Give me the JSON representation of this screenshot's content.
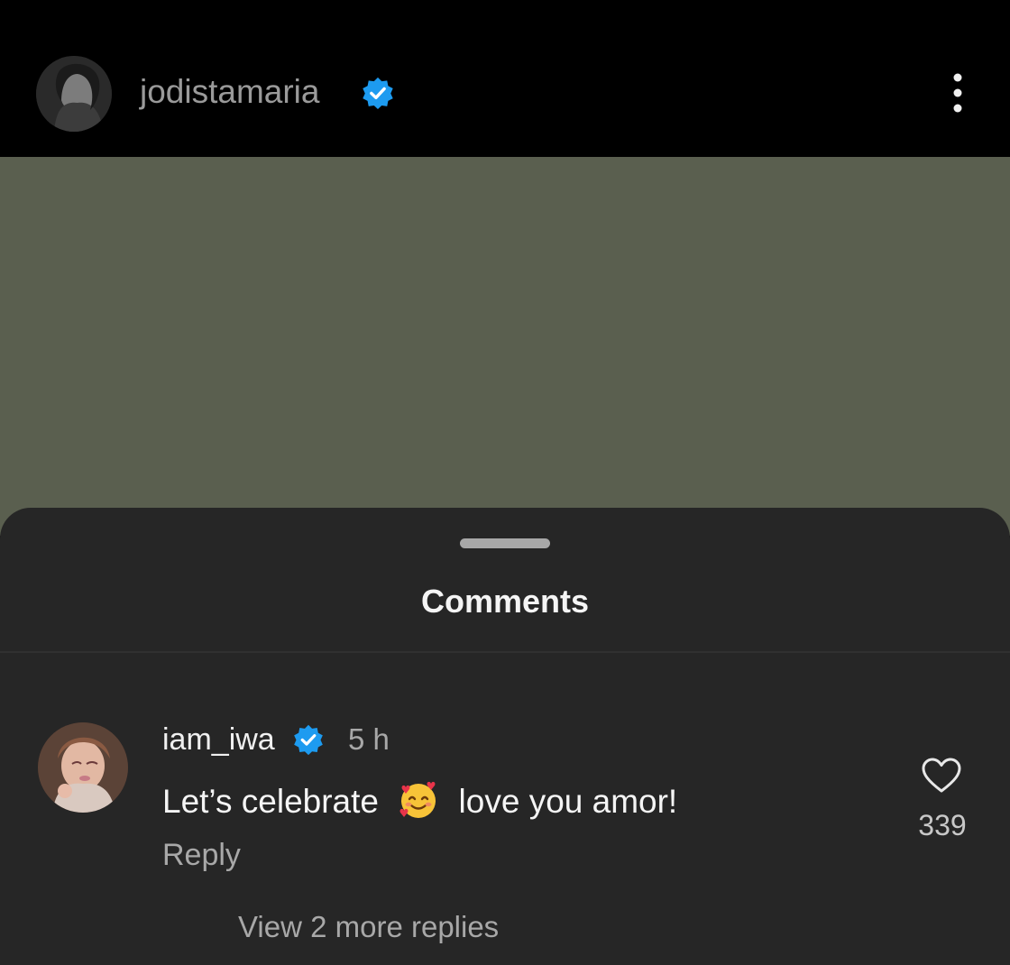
{
  "header": {
    "username": "jodistamaria",
    "avatar_icon": "profile-avatar",
    "verified_icon": "verified-badge-icon",
    "more_icon": "more-options-icon",
    "accent": "#1d9bf0"
  },
  "sheet": {
    "title": "Comments"
  },
  "comments": [
    {
      "username": "iam_iwa",
      "time": "5 h",
      "text_before": "Let’s celebrate",
      "emoji": "🥰",
      "text_after": "love you amor!",
      "reply_label": "Reply",
      "like_count": "339",
      "view_replies_label": "View 2 more replies"
    }
  ],
  "colors": {
    "background": "#000000",
    "media": "#5a5f4f",
    "sheet": "#262626",
    "secondary_text": "#a8a8a8"
  }
}
